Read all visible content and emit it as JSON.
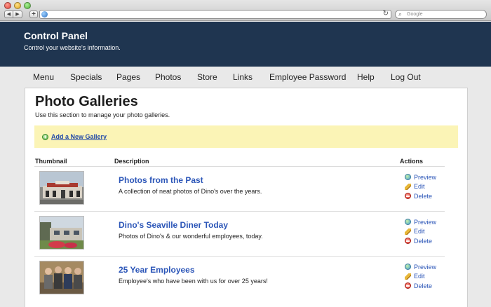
{
  "browser": {
    "search_placeholder": "Google",
    "back_label": "◀",
    "forward_label": "▶",
    "add_label": "+",
    "reload_label": "↻"
  },
  "header": {
    "title": "Control Panel",
    "subtitle": "Control your website's information."
  },
  "nav": {
    "items": [
      {
        "label": "Menu"
      },
      {
        "label": "Specials"
      },
      {
        "label": "Pages"
      },
      {
        "label": "Photos"
      },
      {
        "label": "Store"
      },
      {
        "label": "Links"
      },
      {
        "label": "Employee Password"
      },
      {
        "label": "Help"
      },
      {
        "label": "Log Out"
      }
    ]
  },
  "main": {
    "title": "Photo Galleries",
    "description": "Use this section to manage your photo galleries.",
    "add_link": "Add a New Gallery",
    "columns": {
      "thumbnail": "Thumbnail",
      "description": "Description",
      "actions": "Actions"
    },
    "action_labels": {
      "preview": "Preview",
      "edit": "Edit",
      "delete": "Delete"
    },
    "galleries": [
      {
        "title": "Photos from the Past",
        "description": "A collection of neat photos of Dino's over the years."
      },
      {
        "title": "Dino's Seaville Diner Today",
        "description": "Photos of Dino's & our wonderful employees, today."
      },
      {
        "title": "25 Year Employees",
        "description": "Employee's who have been with us for over 25 years!"
      }
    ]
  },
  "colors": {
    "header_bg": "#1f3550",
    "link": "#2c56b8",
    "add_bar_bg": "#fbf4b6",
    "page_bg": "#e9e9e9"
  }
}
